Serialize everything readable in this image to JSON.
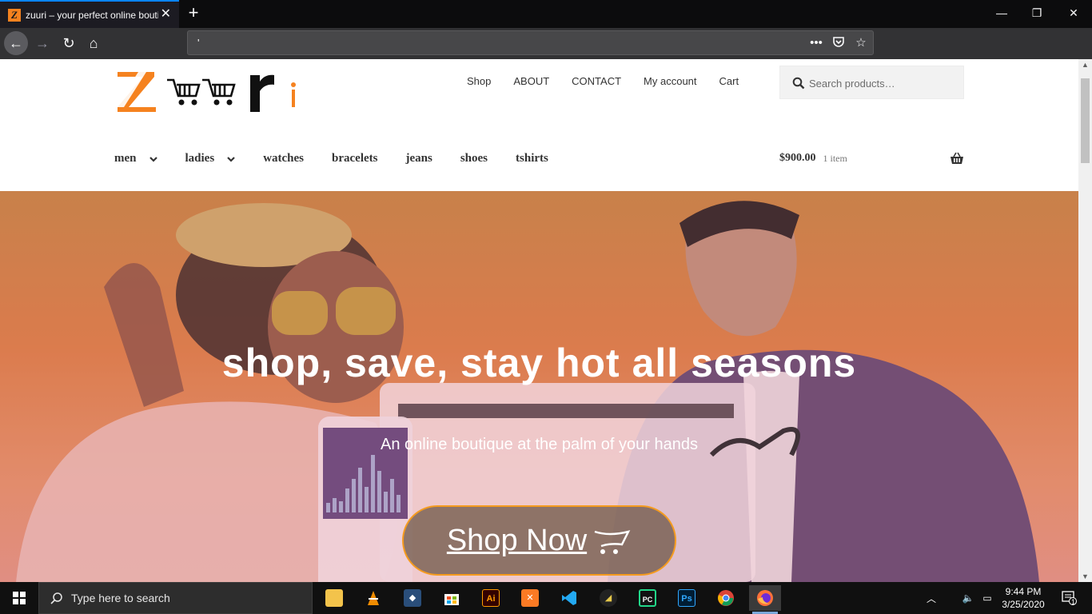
{
  "browser": {
    "tab_title": "zuuri – your perfect online boutique",
    "url": "'"
  },
  "site": {
    "primary_nav": [
      "Shop",
      "ABOUT",
      "CONTACT",
      "My account",
      "Cart"
    ],
    "search_placeholder": "Search products…",
    "categories": [
      {
        "label": "men",
        "has_dropdown": true
      },
      {
        "label": "ladies",
        "has_dropdown": true
      },
      {
        "label": "watches",
        "has_dropdown": false
      },
      {
        "label": "bracelets",
        "has_dropdown": false
      },
      {
        "label": "jeans",
        "has_dropdown": false
      },
      {
        "label": "shoes",
        "has_dropdown": false
      },
      {
        "label": "tshirts",
        "has_dropdown": false
      }
    ],
    "cart": {
      "amount": "$900.00",
      "count": "1 item"
    },
    "hero": {
      "title": "shop, save, stay hot all seasons",
      "subtitle": "An online boutique at the palm of your hands",
      "cta_label": "Shop Now"
    },
    "colors": {
      "accent": "#f5821f",
      "nav_text": "#333333",
      "hero_bg": "#d77434"
    }
  },
  "taskbar": {
    "search_placeholder": "Type here to search",
    "apps": [
      "file-explorer",
      "vlc",
      "mysql-workbench",
      "microsoft-store",
      "adobe-illustrator",
      "xampp",
      "vs-code",
      "inkscape",
      "pycharm",
      "photoshop",
      "chrome",
      "firefox"
    ],
    "time": "9:44 PM",
    "date": "3/25/2020",
    "notification_count": "1"
  }
}
